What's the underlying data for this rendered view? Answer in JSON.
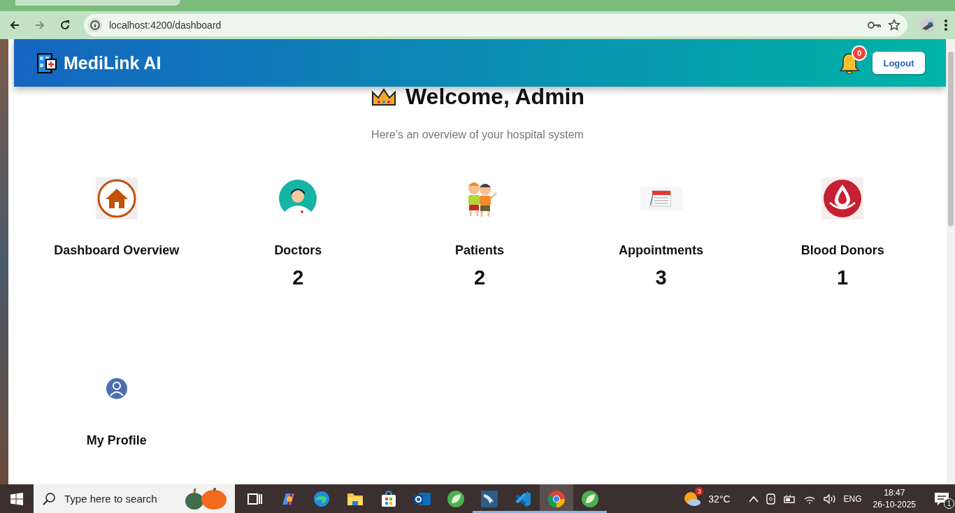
{
  "browser": {
    "address": "localhost:4200/dashboard"
  },
  "header": {
    "brand": "MediLink AI",
    "notification_count": "0",
    "logout": "Logout"
  },
  "welcome": {
    "title": "Welcome, Admin",
    "subtitle": "Here’s an overview of your hospital system"
  },
  "cards": [
    {
      "kind": "home",
      "label": "Dashboard Overview"
    },
    {
      "kind": "doctor",
      "label": "Doctors",
      "count": "2"
    },
    {
      "kind": "patients",
      "label": "Patients",
      "count": "2"
    },
    {
      "kind": "calendar",
      "label": "Appointments",
      "count": "3"
    },
    {
      "kind": "blood",
      "label": "Blood Donors",
      "count": "1"
    },
    {
      "kind": "profile",
      "label": "My Profile"
    }
  ],
  "taskbar": {
    "search_placeholder": "Type here to search",
    "apps": [
      {
        "kind": "taskview",
        "running": false,
        "selected": false
      },
      {
        "kind": "copilot",
        "running": false,
        "selected": false
      },
      {
        "kind": "edge",
        "running": false,
        "selected": false
      },
      {
        "kind": "folder",
        "running": false,
        "selected": false
      },
      {
        "kind": "store",
        "running": false,
        "selected": false
      },
      {
        "kind": "outlook",
        "running": false,
        "selected": false
      },
      {
        "kind": "leaf",
        "running": false,
        "selected": false
      },
      {
        "kind": "dolphin",
        "running": true,
        "selected": false
      },
      {
        "kind": "vscode",
        "running": true,
        "selected": false
      },
      {
        "kind": "chrome",
        "running": true,
        "selected": true
      },
      {
        "kind": "leaf",
        "running": true,
        "selected": false
      }
    ],
    "weather_badge": "3",
    "temperature": "32°C",
    "language": "ENG",
    "time": "18:47",
    "date": "26-10-2025",
    "notification_count": "1"
  }
}
